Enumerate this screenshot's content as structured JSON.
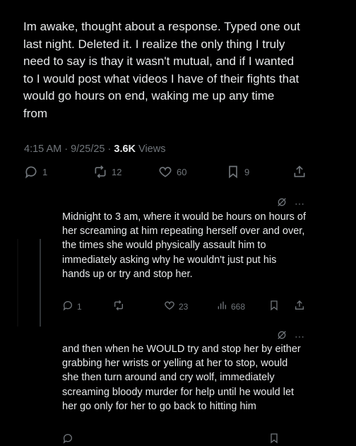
{
  "main_post": {
    "text": "Im awake, thought about a response. Typed one out last night. Deleted it. I realize the only thing I truly need to say is thay it wasn't mutual, and if I wanted to I would post what videos I have of their fights that would go hours on end, waking me up any time from",
    "time": "4:15 AM",
    "date": "9/25/25",
    "views_count": "3.6K",
    "views_label": "Views",
    "replies": "1",
    "reposts": "12",
    "likes": "60",
    "bookmarks": "9"
  },
  "replies": [
    {
      "text": "Midnight to 3 am, where it would be hours on hours of her screaming at him repeating herself over and over, the times she would physically assault him to immediately asking why he wouldn't just put his hands up or try and stop her.",
      "reply_count": "1",
      "repost_count": "",
      "like_count": "23",
      "view_count": "668"
    },
    {
      "text": "and then when he WOULD try and stop her by either grabbing her wrists or yelling at her to stop, would she then turn around and cry wolf, immediately screaming bloody murder for help until he would let her go only for her to go back to hitting him"
    }
  ],
  "icons": {
    "reply": "speech-bubble-icon",
    "repost": "repost-arrows-icon",
    "like": "heart-icon",
    "bookmark": "bookmark-icon",
    "share": "share-icon",
    "grok": "grok-icon",
    "more": "more-dots-icon",
    "views": "bar-chart-icon"
  },
  "colors": {
    "background": "#000000",
    "text": "#e7e9ea",
    "muted": "#71767b"
  }
}
